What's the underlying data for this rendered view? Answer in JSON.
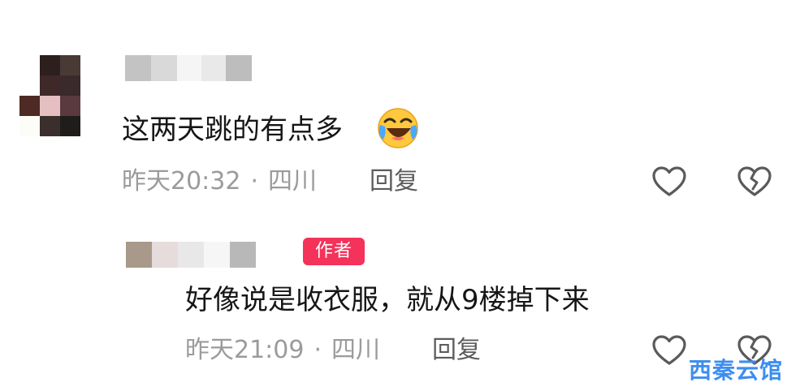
{
  "comment": {
    "text": "这两天跳的有点多",
    "emoji": "laughing-crying-emoji",
    "time": "昨天20:32",
    "separator": "·",
    "location": "四川",
    "reply_label": "回复"
  },
  "reply": {
    "badge": "作者",
    "text": "好像说是收衣服，就从9楼掉下来",
    "time": "昨天21:09",
    "separator": "·",
    "location": "四川",
    "reply_label": "回复"
  },
  "icons": {
    "like": "heart-outline-icon",
    "dislike": "broken-heart-outline-icon"
  },
  "watermark": "西秦云馆",
  "colors": {
    "badge": "#f4325a",
    "meta_text": "#9b9b9b",
    "watermark": "#3d8ef0"
  }
}
